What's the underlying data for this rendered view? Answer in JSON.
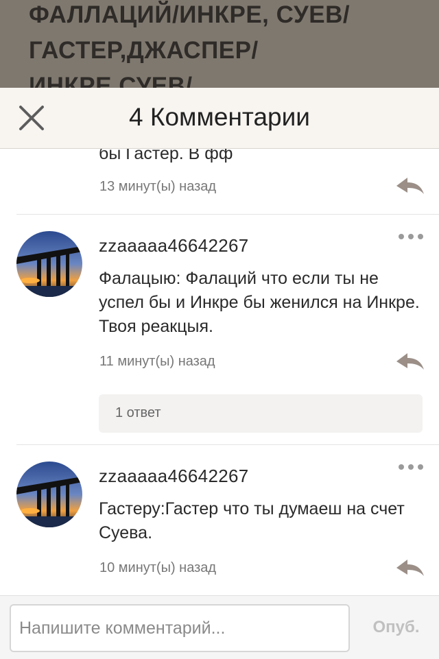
{
  "background": {
    "title": "ФАЛЛАЦИЙ/ИНКРЕ, СУЕВ/ ГАСТЕР,ДЖАСПЕР/ ИНКРЕ,СУЕВ/"
  },
  "header": {
    "title": "4 Комментарии",
    "close_icon": "close-icon"
  },
  "comments": [
    {
      "text": "бы Гастер. В фф",
      "time": "13 минут(ы) назад"
    },
    {
      "username": "zzaaaaa46642267",
      "text": "Фалацыю: Фалаций что если ты не успел бы и Инкре бы женился на Инкре. Твоя реакцыя.",
      "time": "11 минут(ы) назад",
      "replies_label": "1 ответ"
    },
    {
      "username": "zzaaaaa46642267",
      "text": "Гастеру:Гастер что ты думаеш на счет Суева.",
      "time": "10 минут(ы) назад"
    }
  ],
  "composer": {
    "placeholder": "Напишите комментарий...",
    "value": "",
    "publish_label": "Опуб."
  },
  "colors": {
    "overlay": "#7f786f",
    "header_bg": "#f8f5f1",
    "reply_icon": "#9b8f88",
    "publish_disabled": "#c0c0c0"
  }
}
